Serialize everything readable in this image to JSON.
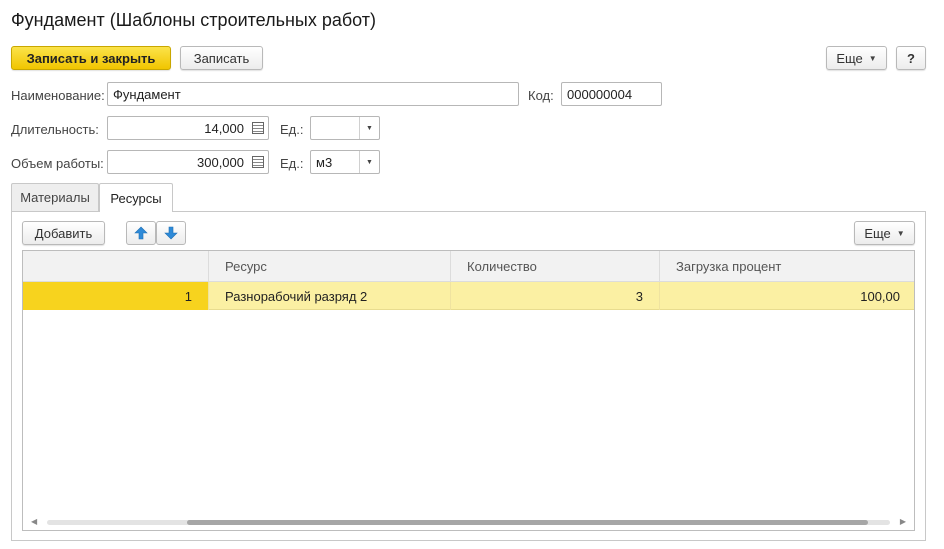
{
  "window": {
    "title": "Фундамент (Шаблоны строительных работ)"
  },
  "toolbar": {
    "save_close_label": "Записать и закрыть",
    "save_label": "Записать",
    "more_label": "Еще",
    "help_label": "?"
  },
  "form": {
    "name_label": "Наименование:",
    "name_value": "Фундамент",
    "code_label": "Код:",
    "code_value": "000000004",
    "duration_label": "Длительность:",
    "duration_value": "14,000",
    "duration_unit_label": "Ед.:",
    "duration_unit_value": "",
    "volume_label": "Объем работы:",
    "volume_value": "300,000",
    "volume_unit_label": "Ед.:",
    "volume_unit_value": "м3"
  },
  "tabs": [
    {
      "label": "Материалы",
      "active": false
    },
    {
      "label": "Ресурсы",
      "active": true
    }
  ],
  "table_toolbar": {
    "add_label": "Добавить",
    "more_label": "Еще"
  },
  "table": {
    "columns": [
      "",
      "Ресурс",
      "Количество",
      "Загрузка процент"
    ],
    "rows": [
      {
        "n": "1",
        "resource": "Разнорабочий разряд 2",
        "qty": "3",
        "load": "100,00"
      }
    ]
  },
  "colors": {
    "primary_button": "#f4ce14",
    "selected_row": "#fbf0a3",
    "selected_cell": "#f7d31e",
    "arrow_icon": "#2e8ad8"
  },
  "icons": [
    "calendar-icon",
    "dropdown-arrow-icon",
    "move-up-icon",
    "move-down-icon",
    "scroll-left-icon",
    "scroll-right-icon"
  ]
}
